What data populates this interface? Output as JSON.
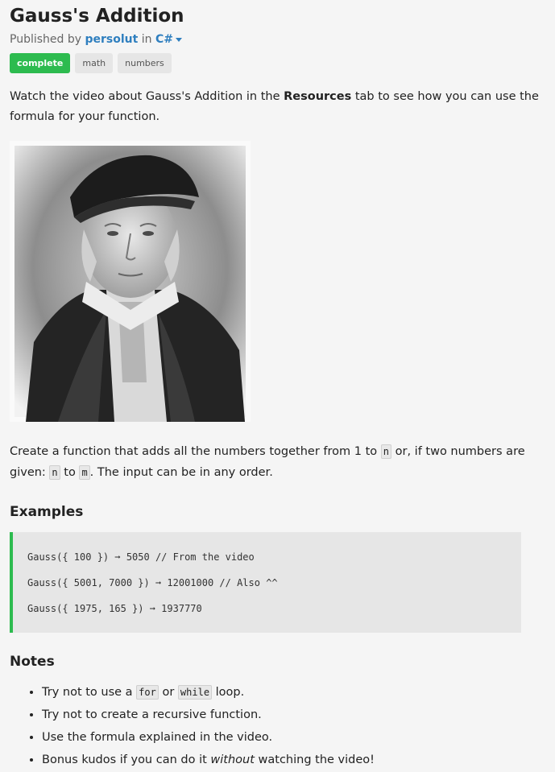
{
  "title": "Gauss's Addition",
  "publish": {
    "prefix": "Published by",
    "author": "persolut",
    "in_word": "in",
    "language": "C#"
  },
  "tags": [
    "complete",
    "math",
    "numbers"
  ],
  "intro": {
    "before": "Watch the video about Gauss's Addition in the ",
    "bold": "Resources",
    "after": " tab to see how you can use the formula for your function."
  },
  "task": {
    "t1": "Create a function that adds all the numbers together from 1 to ",
    "c1": "n",
    "t2": " or, if two numbers are given: ",
    "c2": "n",
    "t3": " to ",
    "c3": "m",
    "t4": ". The input can be in any order."
  },
  "examples_heading": "Examples",
  "examples": [
    "Gauss({ 100 }) ➞ 5050 // From the video",
    "Gauss({ 5001, 7000 }) ➞ 12001000 // Also ^^",
    "Gauss({ 1975, 165 }) ➞ 1937770"
  ],
  "notes_heading": "Notes",
  "notes": {
    "n1": {
      "t1": "Try not to use a ",
      "c1": "for",
      "t2": " or ",
      "c2": "while",
      "t3": " loop."
    },
    "n2": "Try not to create a recursive function.",
    "n3": "Use the formula explained in the video.",
    "n4": {
      "t1": "Bonus kudos if you can do it ",
      "em": "without",
      "t2": " watching the video!"
    }
  },
  "colors": {
    "accent_green": "#2dbb4f",
    "link_blue": "#2f7fbf"
  }
}
